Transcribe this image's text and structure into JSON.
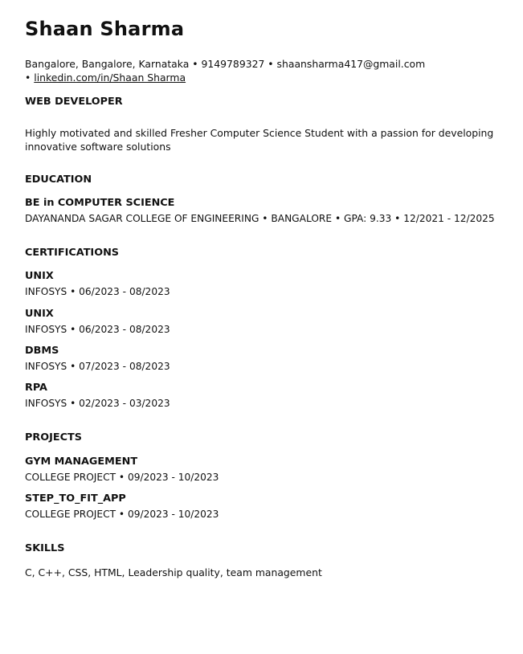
{
  "header": {
    "name": "Shaan Sharma",
    "location": "Bangalore, Bangalore, Karnataka",
    "phone": "9149789327",
    "email": "shaansharma417@gmail.com",
    "linkedin": "linkedin.com/in/Shaan Sharma",
    "separator": " • "
  },
  "title_section": {
    "heading": "WEB DEVELOPER",
    "summary": "Highly motivated and skilled Fresher Computer Science Student with a passion for developing innovative software solutions"
  },
  "education": {
    "heading": "EDUCATION",
    "items": [
      {
        "degree": "BE in COMPUTER SCIENCE",
        "meta": "DAYANANDA SAGAR COLLEGE OF ENGINEERING • BANGALORE • GPA: 9.33 • 12/2021 - 12/2025"
      }
    ]
  },
  "certifications": {
    "heading": "CERTIFICATIONS",
    "items": [
      {
        "title": "UNIX",
        "meta": "INFOSYS • 06/2023 - 08/2023"
      },
      {
        "title": "UNIX",
        "meta": "INFOSYS • 06/2023 - 08/2023"
      },
      {
        "title": "DBMS",
        "meta": "INFOSYS • 07/2023 - 08/2023"
      },
      {
        "title": "RPA",
        "meta": "INFOSYS • 02/2023 - 03/2023"
      }
    ]
  },
  "projects": {
    "heading": "PROJECTS",
    "items": [
      {
        "title": "GYM MANAGEMENT",
        "meta": "COLLEGE PROJECT • 09/2023 - 10/2023"
      },
      {
        "title": "STEP_TO_FIT_APP",
        "meta": "COLLEGE PROJECT • 09/2023 - 10/2023"
      }
    ]
  },
  "skills": {
    "heading": "SKILLS",
    "text": "C, C++, CSS, HTML, Leadership quality, team management"
  }
}
